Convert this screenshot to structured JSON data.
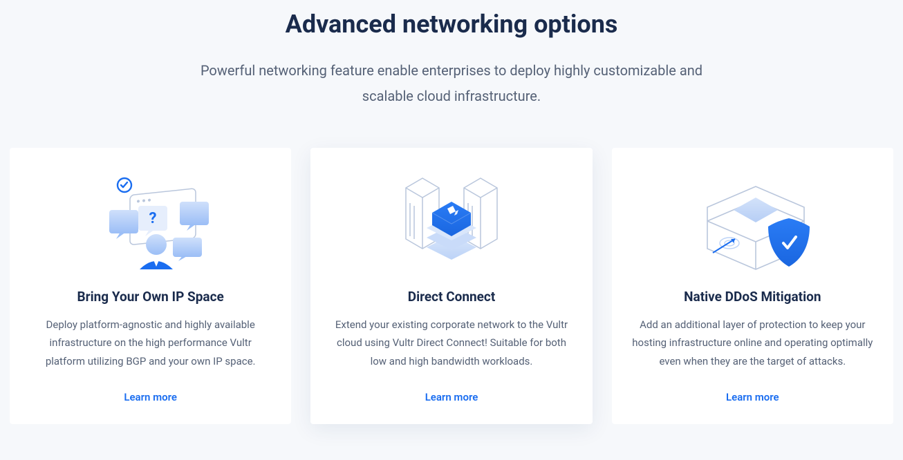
{
  "header": {
    "title": "Advanced networking options",
    "subtitle": "Powerful networking feature enable enterprises to deploy highly customizable and scalable cloud infrastructure."
  },
  "cards": [
    {
      "title": "Bring Your Own IP Space",
      "desc": "Deploy platform-agnostic and highly available infrastructure on the high performance Vultr platform utilizing BGP and your own IP space.",
      "cta": "Learn more"
    },
    {
      "title": "Direct Connect",
      "desc": "Extend your existing corporate network to the Vultr cloud using Vultr Direct Connect! Suitable for both low and high bandwidth workloads.",
      "cta": "Learn more"
    },
    {
      "title": "Native DDoS Mitigation",
      "desc": "Add an additional layer of protection to keep your hosting infrastructure online and operating optimally even when they are the target of attacks.",
      "cta": "Learn more"
    }
  ]
}
